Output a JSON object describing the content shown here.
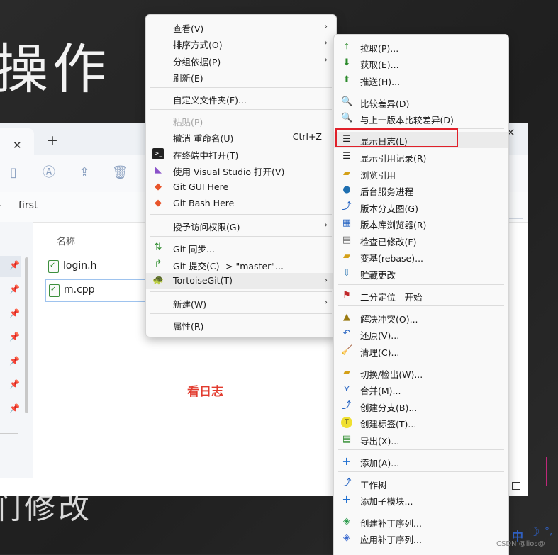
{
  "slide": {
    "title_fragment": "操作",
    "bottom_fragment": "们修改",
    "annotation": "看日志"
  },
  "explorer": {
    "tab_close": "✕",
    "tab_add": "+",
    "window_close": "✕",
    "address_sep": "›",
    "address_folder": "first",
    "column_name": "名称",
    "files": [
      "login.h",
      "m.cpp"
    ]
  },
  "menu1": {
    "items": [
      {
        "label": "查看(V)",
        "submenu": true
      },
      {
        "label": "排序方式(O)",
        "submenu": true
      },
      {
        "label": "分组依据(P)",
        "submenu": true
      },
      {
        "label": "刷新(E)"
      },
      {
        "label": "自定义文件夹(F)..."
      },
      {
        "label": "粘贴(P)",
        "disabled": true
      },
      {
        "label": "撤消 重命名(U)",
        "shortcut": "Ctrl+Z"
      },
      {
        "label": "在终端中打开(T)",
        "icon": "terminal-icon"
      },
      {
        "label": "使用 Visual Studio 打开(V)",
        "icon": "visual-studio-icon"
      },
      {
        "label": "Git GUI Here",
        "icon": "git-icon"
      },
      {
        "label": "Git Bash Here",
        "icon": "git-icon"
      },
      {
        "label": "授予访问权限(G)",
        "submenu": true
      },
      {
        "label": "Git 同步...",
        "icon": "git-sync-icon"
      },
      {
        "label": "Git 提交(C) -> \"master\"...",
        "icon": "git-commit-icon"
      },
      {
        "label": "TortoiseGit(T)",
        "submenu": true,
        "highlighted": true,
        "icon": "tortoisegit-icon"
      },
      {
        "label": "新建(W)",
        "submenu": true
      },
      {
        "label": "属性(R)"
      }
    ],
    "arrow": "›"
  },
  "menu2": {
    "items": [
      {
        "label": "拉取(P)...",
        "icon": "pull-icon"
      },
      {
        "label": "获取(E)...",
        "icon": "fetch-icon"
      },
      {
        "label": "推送(H)...",
        "icon": "push-icon"
      },
      {
        "label": "比较差异(D)",
        "icon": "diff-icon"
      },
      {
        "label": "与上一版本比较差异(D)",
        "icon": "diff-prev-icon"
      },
      {
        "label": "显示日志(L)",
        "icon": "log-icon",
        "highlighted": true
      },
      {
        "label": "显示引用记录(R)",
        "icon": "reflog-icon"
      },
      {
        "label": "浏览引用",
        "icon": "browse-refs-icon"
      },
      {
        "label": "后台服务进程",
        "icon": "daemon-icon"
      },
      {
        "label": "版本分支图(G)",
        "icon": "revision-graph-icon"
      },
      {
        "label": "版本库浏览器(R)",
        "icon": "repo-browser-icon"
      },
      {
        "label": "检查已修改(F)",
        "icon": "check-modifications-icon"
      },
      {
        "label": "变基(rebase)...",
        "icon": "rebase-icon"
      },
      {
        "label": "贮藏更改",
        "icon": "stash-icon"
      },
      {
        "label": "二分定位 - 开始",
        "icon": "bisect-icon"
      },
      {
        "label": "解决冲突(O)...",
        "icon": "resolve-icon"
      },
      {
        "label": "还原(V)...",
        "icon": "revert-icon"
      },
      {
        "label": "清理(C)...",
        "icon": "cleanup-icon"
      },
      {
        "label": "切换/检出(W)...",
        "icon": "switch-icon"
      },
      {
        "label": "合并(M)...",
        "icon": "merge-icon"
      },
      {
        "label": "创建分支(B)...",
        "icon": "branch-icon"
      },
      {
        "label": "创建标签(T)...",
        "icon": "tag-icon"
      },
      {
        "label": "导出(X)...",
        "icon": "export-icon"
      },
      {
        "label": "添加(A)...",
        "icon": "add-icon"
      },
      {
        "label": "工作树",
        "icon": "worktree-icon"
      },
      {
        "label": "添加子模块...",
        "icon": "submodule-icon"
      },
      {
        "label": "创建补丁序列...",
        "icon": "create-patch-icon"
      },
      {
        "label": "应用补丁序列...",
        "icon": "apply-patch-icon"
      }
    ]
  },
  "ime": {
    "text": "中",
    "moon": "☽",
    "dots": "°,"
  },
  "watermark": "CSDN @lios@",
  "colors": {
    "highlight_border": "#e0202a",
    "annotation": "#e23b2e"
  }
}
